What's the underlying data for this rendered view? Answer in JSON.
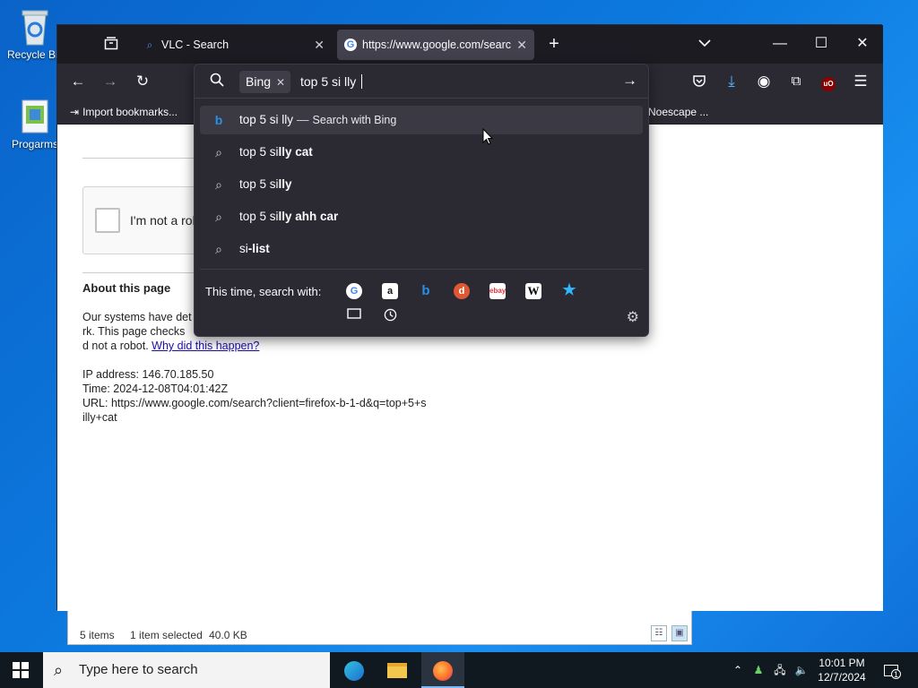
{
  "desktop": {
    "icons": [
      {
        "label": "Recycle Bin",
        "icon": "recycle-bin-icon"
      },
      {
        "label": "Progarms",
        "icon": "folder-icon"
      }
    ]
  },
  "explorer": {
    "items_count": "5 items",
    "selection": "1 item selected",
    "size": "40.0 KB"
  },
  "browser": {
    "tabs": [
      {
        "title": "VLC - Search",
        "icon": "search-icon",
        "active": false
      },
      {
        "title": "https://www.google.com/searc",
        "icon": "google-icon",
        "active": true
      }
    ],
    "new_tab_label": "+",
    "bookmarks": [
      {
        "label": "Import bookmarks...",
        "icon": "import-icon"
      },
      {
        "label": "Noescape ...",
        "icon": ""
      }
    ],
    "urlbar": {
      "engine_chip": "Bing",
      "typed_text": "top 5 si lly",
      "suggestions": [
        {
          "icon": "bing-icon",
          "text": "top 5 si lly",
          "separator": "—",
          "extra": "Search with Bing",
          "highlighted": true
        },
        {
          "icon": "search-icon",
          "normal": "top 5 si",
          "bold": "lly cat"
        },
        {
          "icon": "search-icon",
          "normal": "top 5 si",
          "bold": "lly"
        },
        {
          "icon": "search-icon",
          "normal": "top 5 si",
          "bold": "lly ahh car"
        },
        {
          "icon": "search-icon",
          "normal": "si",
          "bold": "-list"
        }
      ],
      "search_with_label": "This time, search with:",
      "engines": [
        "google",
        "amazon",
        "bing",
        "duckduckgo",
        "ebay",
        "wikipedia",
        "bookmarks-star"
      ]
    }
  },
  "page": {
    "captcha_label": "I'm not a robot",
    "about_heading": "About this page",
    "line1": "Our systems have det",
    "line2": "rk. This page checks",
    "line3_prefix": "d not a robot.",
    "line3_link": "Why did this happen?",
    "ip": "IP address: 146.70.185.50",
    "time": "Time: 2024-12-08T04:01:42Z",
    "url1": "URL: https://www.google.com/search?client=firefox-b-1-d&q=top+5+s",
    "url2": "illy+cat"
  },
  "taskbar": {
    "search_placeholder": "Type here to search",
    "time": "10:01 PM",
    "date": "12/7/2024",
    "notification_count": "1"
  },
  "colors": {
    "desktop": "#0c7ae0",
    "firefox_toolbar": "#2b2a33",
    "firefox_tabbar": "#1c1b22",
    "accent_link": "#1a0dab"
  }
}
